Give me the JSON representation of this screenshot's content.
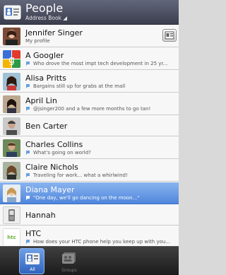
{
  "header": {
    "title": "People",
    "subtitle": "Address Book ◢"
  },
  "contacts": [
    {
      "name": "Jennifer Singer",
      "status": "My profile",
      "icon": "jennifer-avatar"
    },
    {
      "name": "A Googler",
      "status": "Who drove the most impt tech development in 25 yr...",
      "icon": "google-logo"
    },
    {
      "name": "Alisa Pritts",
      "status": "Bargains still up for grabs at the mall",
      "icon": "alisa-avatar"
    },
    {
      "name": "April Lin",
      "status": "@jsinger200 and a few more months to go tan!",
      "icon": "april-avatar"
    },
    {
      "name": "Ben Carter",
      "status": "",
      "icon": "ben-avatar"
    },
    {
      "name": "Charles Collins",
      "status": "What's going on world?",
      "icon": "charles-avatar"
    },
    {
      "name": "Claire Nichols",
      "status": "Traveling for work... what a whirlwind!",
      "icon": "claire-avatar"
    },
    {
      "name": "Diana Mayer",
      "status": "\"One day, we'll go dancing on the moon...\"",
      "icon": "diana-avatar"
    },
    {
      "name": "Hannah",
      "status": "",
      "icon": "phone-icon"
    },
    {
      "name": "HTC",
      "status": "How does your HTC phone help you keep up with you...",
      "icon": "htc-logo"
    }
  ],
  "tabs": [
    {
      "label": "All"
    },
    {
      "label": "Groups"
    }
  ],
  "colors": {
    "header": "#4a4d5e",
    "selected": "#5a8fe0",
    "tabbar": "#2b2b2b"
  }
}
